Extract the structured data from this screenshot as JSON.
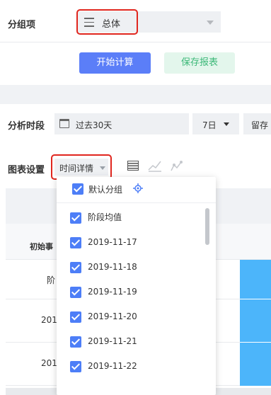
{
  "group": {
    "label": "分组项",
    "value": "总体"
  },
  "actions": {
    "calc_label": "开始计算",
    "save_label": "保存报表"
  },
  "period": {
    "label": "分析时段",
    "range_value": "过去30天",
    "granularity": "7日",
    "retention_cut": "留存"
  },
  "chart_settings": {
    "label": "图表设置",
    "view_value": "时间详情"
  },
  "table_bg": {
    "col_header": "初始事",
    "rows": [
      "阶",
      "201",
      "201"
    ]
  },
  "dropdown": {
    "default_group": "默认分组",
    "items": [
      "阶段均值",
      "2019-11-17",
      "2019-11-18",
      "2019-11-19",
      "2019-11-20",
      "2019-11-21",
      "2019-11-22"
    ]
  },
  "colors": {
    "primary": "#5b7ef8",
    "save_bg": "#e3f6ec",
    "save_text": "#3cb878",
    "checkbox": "#4d7ef7",
    "bar_blue": "#4cb5fa",
    "highlight": "#e0261e"
  }
}
